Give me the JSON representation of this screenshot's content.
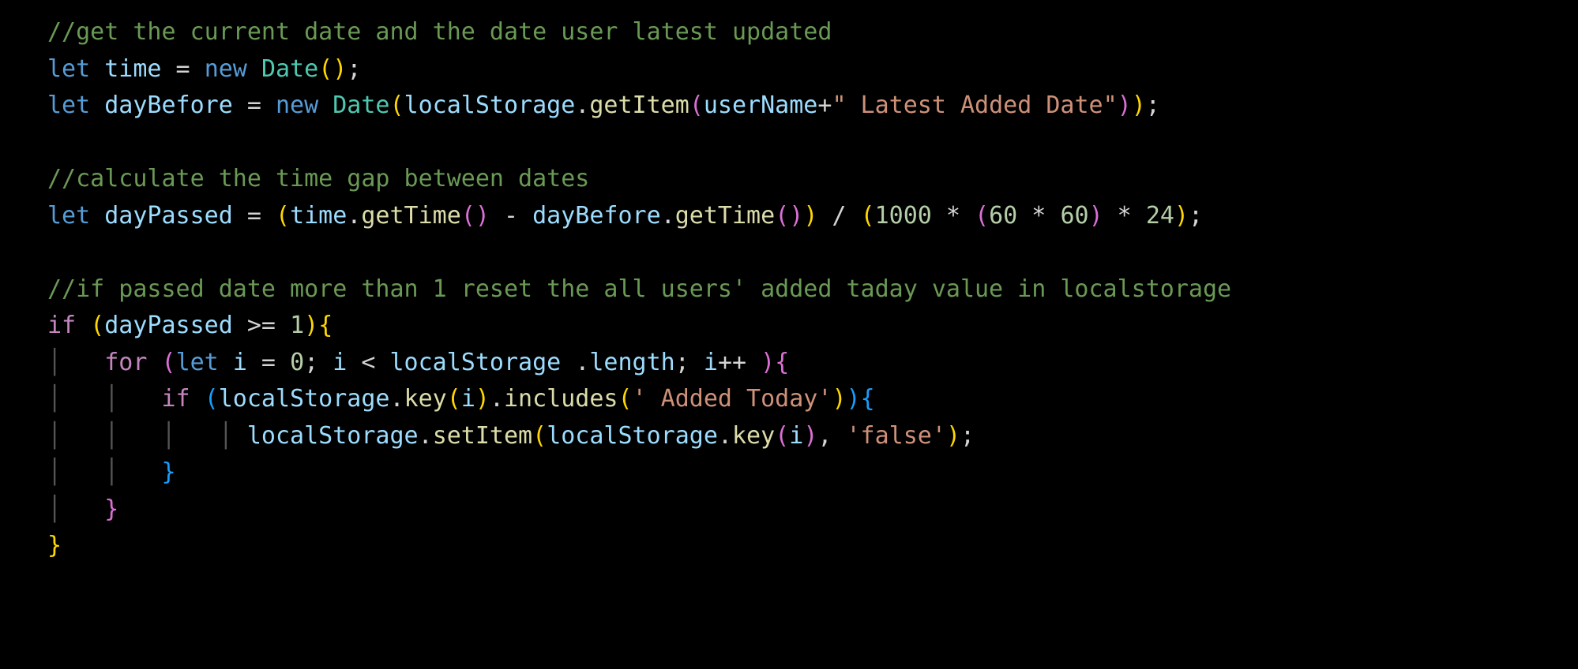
{
  "code": {
    "line1_comment": "//get the current date and the date user latest updated",
    "line2_let": "let",
    "line2_var": "time",
    "line2_eq": " = ",
    "line2_new": "new",
    "line2_sp": " ",
    "line2_cls": "Date",
    "line2_op": "(",
    "line2_cp": ")",
    "line2_semi": ";",
    "line3_let": "let",
    "line3_var": "dayBefore",
    "line3_eq": " = ",
    "line3_new": "new",
    "line3_sp": " ",
    "line3_cls": "Date",
    "line3_op": "(",
    "line3_obj": "localStorage",
    "line3_dot": ".",
    "line3_fn": "getItem",
    "line3_op2": "(",
    "line3_arg": "userName",
    "line3_plus": "+",
    "line3_str": "\" Latest Added Date\"",
    "line3_cp2": ")",
    "line3_cp": ")",
    "line3_semi": ";",
    "line5_comment": "//calculate the time gap between dates",
    "line6_let": "let",
    "line6_var": "dayPassed",
    "line6_eq": " = ",
    "line6_op": "(",
    "line6_v1": "time",
    "line6_dot1": ".",
    "line6_fn1": "getTime",
    "line6_p1o": "(",
    "line6_p1c": ")",
    "line6_minus": " - ",
    "line6_v2": "dayBefore",
    "line6_dot2": ".",
    "line6_fn2": "getTime",
    "line6_p2o": "(",
    "line6_p2c": ")",
    "line6_cp": ")",
    "line6_div": " / ",
    "line6_op2": "(",
    "line6_n1": "1000",
    "line6_mul1": " * ",
    "line6_op3": "(",
    "line6_n2": "60",
    "line6_mul2": " * ",
    "line6_n3": "60",
    "line6_cp3": ")",
    "line6_mul3": " * ",
    "line6_n4": "24",
    "line6_cp2": ")",
    "line6_semi": ";",
    "line8_comment": "//if passed date more than 1 reset the all users' added taday value in localstorage",
    "line9_if": "if",
    "line9_sp": " ",
    "line9_op": "(",
    "line9_var": "dayPassed",
    "line9_cmp": " >= ",
    "line9_num": "1",
    "line9_cp": ")",
    "line9_ob": "{",
    "line10_for": "for",
    "line10_sp": " ",
    "line10_op": "(",
    "line10_let": "let",
    "line10_sp2": " ",
    "line10_i": "i",
    "line10_eq": " = ",
    "line10_zero": "0",
    "line10_semi1": "; ",
    "line10_i2": "i",
    "line10_lt": " < ",
    "line10_obj": "localStorage",
    "line10_sp3": " ",
    "line10_dot": ".",
    "line10_len": "length",
    "line10_semi2": "; ",
    "line10_i3": "i",
    "line10_inc": "++",
    "line10_sp4": " ",
    "line10_cp": ")",
    "line10_ob": "{",
    "line11_if": "if",
    "line11_sp": " ",
    "line11_op": "(",
    "line11_obj": "localStorage",
    "line11_dot1": ".",
    "line11_fn1": "key",
    "line11_op2": "(",
    "line11_i": "i",
    "line11_cp2": ")",
    "line11_dot2": ".",
    "line11_fn2": "includes",
    "line11_op3": "(",
    "line11_str": "' Added Today'",
    "line11_cp3": ")",
    "line11_cp": ")",
    "line11_ob": "{",
    "line12_obj": "localStorage",
    "line12_dot": ".",
    "line12_fn": "setItem",
    "line12_op": "(",
    "line12_obj2": "localStorage",
    "line12_dot2": ".",
    "line12_fn2": "key",
    "line12_op2": "(",
    "line12_i": "i",
    "line12_cp2": ")",
    "line12_comma": ", ",
    "line12_str": "'false'",
    "line12_cp": ")",
    "line12_semi": ";",
    "line13_cb": "}",
    "line14_cb": "}",
    "line15_cb": "}"
  }
}
